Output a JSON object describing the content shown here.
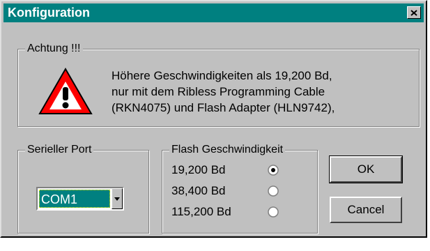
{
  "window": {
    "title": "Konfiguration",
    "close_icon": "close-icon",
    "colors": {
      "titlebar": "#008080",
      "face": "#c0c0c0"
    }
  },
  "warning": {
    "group_label": "Achtung !!!",
    "icon": "warning-triangle-icon",
    "lines": [
      "Höhere Geschwindigkeiten als 19,200 Bd,",
      "nur mit dem Ribless Programming Cable",
      "(RKN4075) und Flash Adapter (HLN9742),"
    ]
  },
  "serial_port": {
    "group_label": "Serieller Port",
    "selected": "COM1",
    "dropdown_icon": "chevron-down-icon"
  },
  "flash_speed": {
    "group_label": "Flash Geschwindigkeit",
    "options": [
      {
        "label": "19,200 Bd",
        "checked": true
      },
      {
        "label": "38,400 Bd",
        "checked": false
      },
      {
        "label": "115,200 Bd",
        "checked": false
      }
    ]
  },
  "buttons": {
    "ok_label": "OK",
    "cancel_label": "Cancel"
  }
}
